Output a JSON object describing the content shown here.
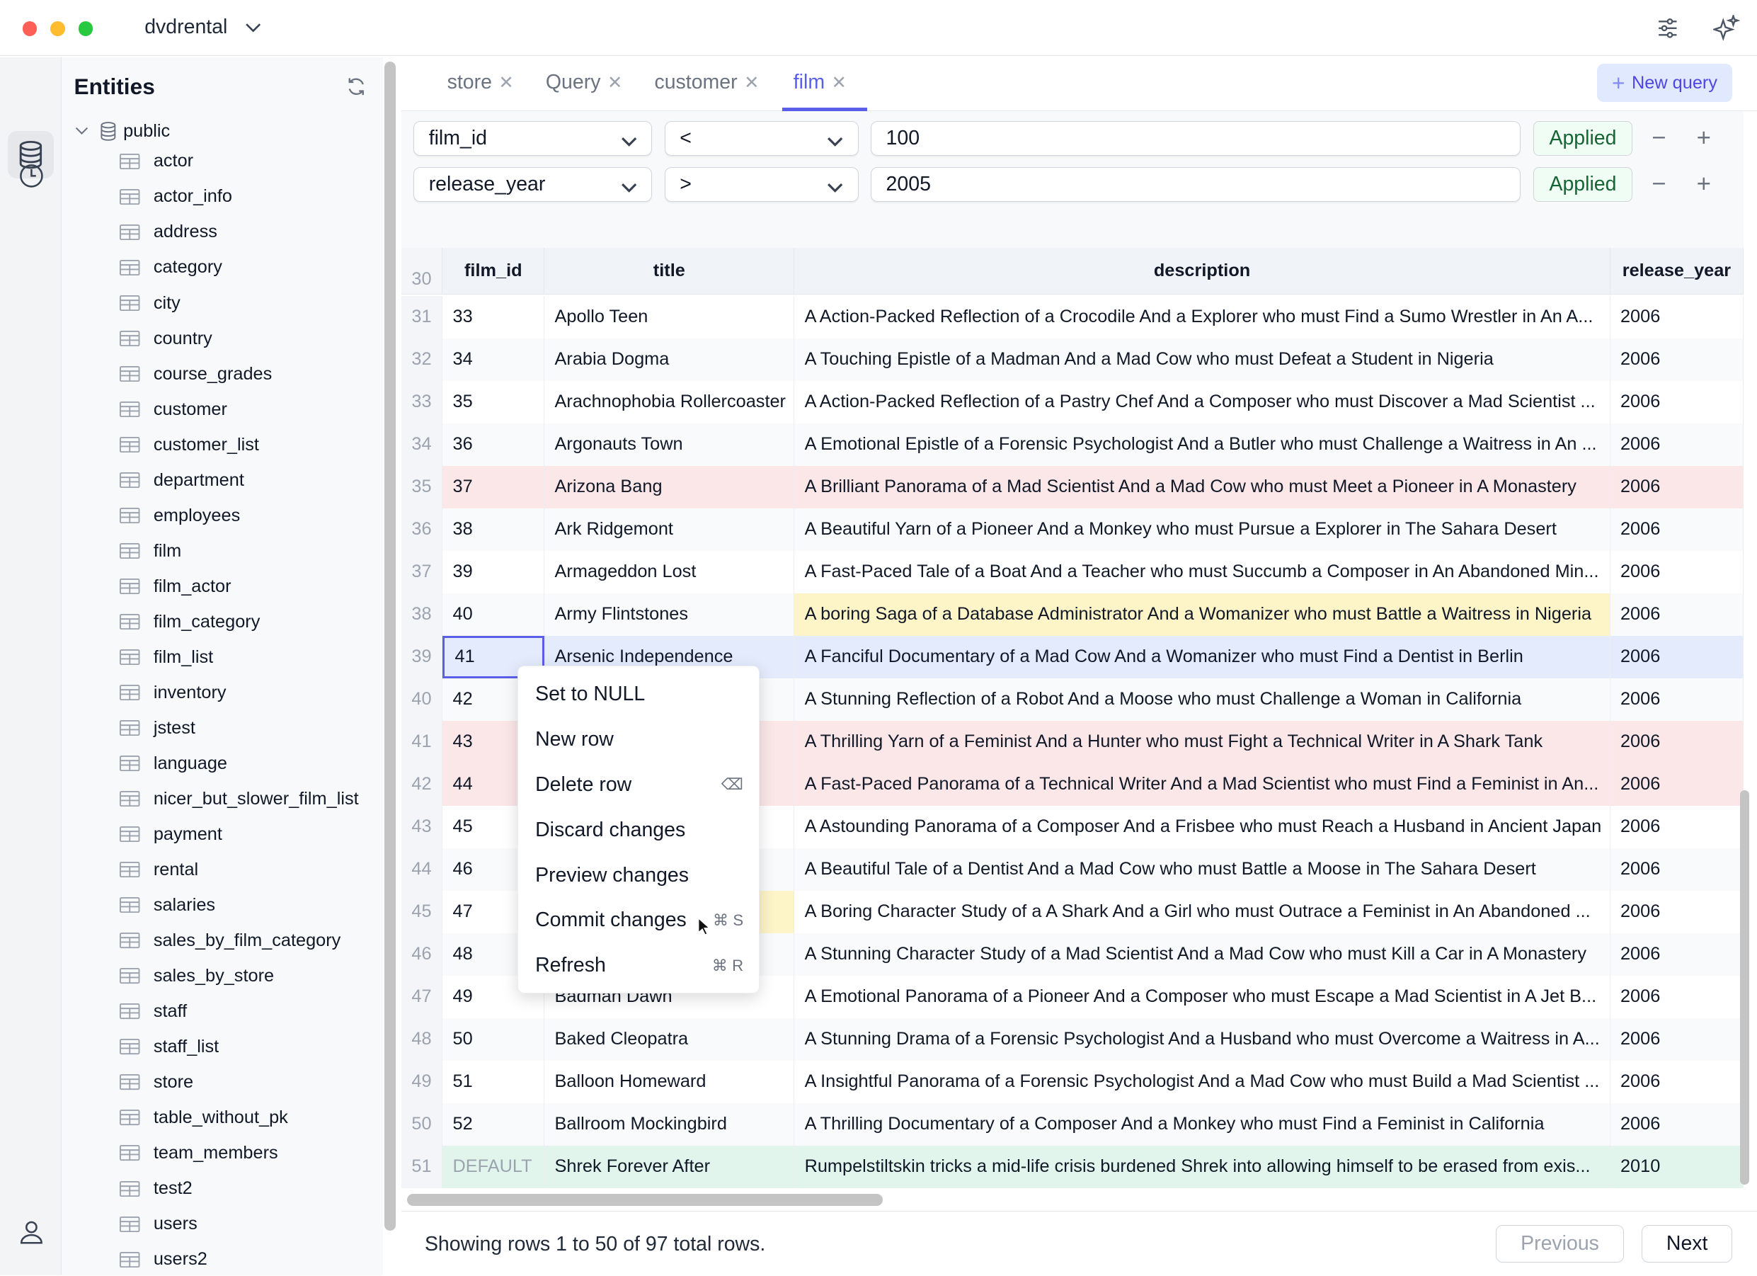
{
  "window": {
    "title": "dvdrental",
    "traffic_lights": [
      "#fe5f57",
      "#febc2e",
      "#28c840"
    ]
  },
  "toolbar_icons": [
    "sliders-icon",
    "sparkles-icon"
  ],
  "sidebar": {
    "title": "Entities",
    "schema": "public",
    "items": [
      "actor",
      "actor_info",
      "address",
      "category",
      "city",
      "country",
      "course_grades",
      "customer",
      "customer_list",
      "department",
      "employees",
      "film",
      "film_actor",
      "film_category",
      "film_list",
      "inventory",
      "jstest",
      "language",
      "nicer_but_slower_film_list",
      "payment",
      "rental",
      "salaries",
      "sales_by_film_category",
      "sales_by_store",
      "staff",
      "staff_list",
      "store",
      "table_without_pk",
      "team_members",
      "test2",
      "users",
      "users2"
    ]
  },
  "tabs": [
    {
      "label": "store"
    },
    {
      "label": "Query"
    },
    {
      "label": "customer"
    },
    {
      "label": "film",
      "active": true
    }
  ],
  "new_query_label": "New query",
  "accent": "#5b5fe8",
  "filters": [
    {
      "column": "film_id",
      "operator": "<",
      "value": "100",
      "status": "Applied"
    },
    {
      "column": "release_year",
      "operator": ">",
      "value": "2005",
      "status": "Applied"
    }
  ],
  "table": {
    "header_rownum": "30",
    "columns": [
      "film_id",
      "title",
      "description",
      "release_year"
    ],
    "rows": [
      {
        "n": "31",
        "id": "33",
        "title": "Apollo Teen",
        "desc": "A Action-Packed Reflection of a Crocodile And a Explorer who must Find a Sumo Wrestler in An A...",
        "year": "2006"
      },
      {
        "n": "32",
        "id": "34",
        "title": "Arabia Dogma",
        "desc": "A Touching Epistle of a Madman And a Mad Cow who must Defeat a Student in Nigeria",
        "year": "2006"
      },
      {
        "n": "33",
        "id": "35",
        "title": "Arachnophobia Rollercoaster",
        "desc": "A Action-Packed Reflection of a Pastry Chef And a Composer who must Discover a Mad Scientist ...",
        "year": "2006"
      },
      {
        "n": "34",
        "id": "36",
        "title": "Argonauts Town",
        "desc": "A Emotional Epistle of a Forensic Psychologist And a Butler who must Challenge a Waitress in An ...",
        "year": "2006"
      },
      {
        "n": "35",
        "id": "37",
        "title": "Arizona Bang",
        "desc": "A Brilliant Panorama of a Mad Scientist And a Mad Cow who must Meet a Pioneer in A Monastery",
        "year": "2006",
        "state": "deleted"
      },
      {
        "n": "36",
        "id": "38",
        "title": "Ark Ridgemont",
        "desc": "A Beautiful Yarn of a Pioneer And a Monkey who must Pursue a Explorer in The Sahara Desert",
        "year": "2006"
      },
      {
        "n": "37",
        "id": "39",
        "title": "Armageddon Lost",
        "desc": "A Fast-Paced Tale of a Boat And a Teacher who must Succumb a Composer in An Abandoned Min...",
        "year": "2006"
      },
      {
        "n": "38",
        "id": "40",
        "title": "Army Flintstones",
        "desc": "A boring Saga of a Database Administrator And a Womanizer who must Battle a Waitress in Nigeria",
        "year": "2006",
        "edited": "desc"
      },
      {
        "n": "39",
        "id": "41",
        "title": "Arsenic Independence",
        "desc": "A Fanciful Documentary of a Mad Cow And a Womanizer who must Find a Dentist in Berlin",
        "year": "2006",
        "state": "selected"
      },
      {
        "n": "40",
        "id": "42",
        "title": "",
        "desc": "A Stunning Reflection of a Robot And a Moose who must Challenge a Woman in California",
        "year": "2006"
      },
      {
        "n": "41",
        "id": "43",
        "title": "",
        "desc": "A Thrilling Yarn of a Feminist And a Hunter who must Fight a Technical Writer in A Shark Tank",
        "year": "2006",
        "state": "deleted"
      },
      {
        "n": "42",
        "id": "44",
        "title": "",
        "desc": "A Fast-Paced Panorama of a Technical Writer And a Mad Scientist who must Find a Feminist in An...",
        "year": "2006",
        "state": "deleted"
      },
      {
        "n": "43",
        "id": "45",
        "title": "",
        "desc": "A Astounding Panorama of a Composer And a Frisbee who must Reach a Husband in Ancient Japan",
        "year": "2006"
      },
      {
        "n": "44",
        "id": "46",
        "title": "",
        "desc": "A Beautiful Tale of a Dentist And a Mad Cow who must Battle a Moose in The Sahara Desert",
        "year": "2006"
      },
      {
        "n": "45",
        "id": "47",
        "title": "",
        "desc": "A Boring Character Study of a A Shark And a Girl who must Outrace a Feminist in An Abandoned ...",
        "year": "2006",
        "edited": "title"
      },
      {
        "n": "46",
        "id": "48",
        "title": "",
        "desc": "A Stunning Character Study of a Mad Scientist And a Mad Cow who must Kill a Car in A Monastery",
        "year": "2006"
      },
      {
        "n": "47",
        "id": "49",
        "title": "Badman Dawn",
        "desc": "A Emotional Panorama of a Pioneer And a Composer who must Escape a Mad Scientist in A Jet B...",
        "year": "2006"
      },
      {
        "n": "48",
        "id": "50",
        "title": "Baked Cleopatra",
        "desc": "A Stunning Drama of a Forensic Psychologist And a Husband who must Overcome a Waitress in A...",
        "year": "2006"
      },
      {
        "n": "49",
        "id": "51",
        "title": "Balloon Homeward",
        "desc": "A Insightful Panorama of a Forensic Psychologist And a Mad Cow who must Build a Mad Scientist ...",
        "year": "2006"
      },
      {
        "n": "50",
        "id": "52",
        "title": "Ballroom Mockingbird",
        "desc": "A Thrilling Documentary of a Composer And a Monkey who must Find a Feminist in California",
        "year": "2006"
      },
      {
        "n": "51",
        "id": "DEFAULT",
        "title": "Shrek Forever After",
        "desc": "Rumpelstiltskin tricks a mid-life crisis burdened Shrek into allowing himself to be erased from exis...",
        "year": "2010",
        "state": "new"
      }
    ]
  },
  "state_colors": {
    "deleted": "#fbe7e7",
    "edited": "#fdf4c8",
    "selected": "#e3ebfc",
    "new": "#e1f5ec"
  },
  "context_menu": [
    {
      "label": "Set to NULL",
      "shortcut": ""
    },
    {
      "label": "New row",
      "shortcut": ""
    },
    {
      "label": "Delete row",
      "shortcut": "⌫"
    },
    {
      "label": "Discard changes",
      "shortcut": ""
    },
    {
      "label": "Preview changes",
      "shortcut": ""
    },
    {
      "label": "Commit changes",
      "shortcut": "⌘ S"
    },
    {
      "label": "Refresh",
      "shortcut": "⌘ R"
    }
  ],
  "footer": {
    "status": "Showing rows 1 to 50 of 97 total rows.",
    "previous": "Previous",
    "next": "Next"
  }
}
